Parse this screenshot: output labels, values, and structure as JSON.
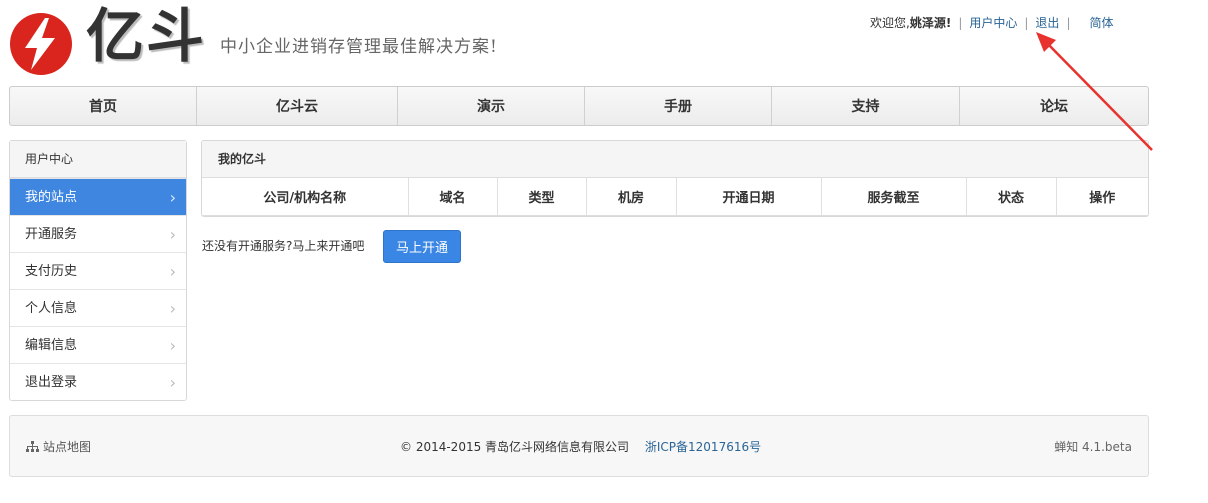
{
  "header": {
    "brand": "亿斗",
    "slogan": "中小企业进销存管理最佳解决方案!",
    "greeting": "欢迎您,",
    "username": "姚泽源!",
    "user_center": "用户中心",
    "logout": "退出",
    "language": "简体"
  },
  "nav": [
    {
      "label": "首页"
    },
    {
      "label": "亿斗云"
    },
    {
      "label": "演示"
    },
    {
      "label": "手册"
    },
    {
      "label": "支持"
    },
    {
      "label": "论坛"
    }
  ],
  "sidebar": {
    "title": "用户中心",
    "items": [
      {
        "label": "我的站点",
        "active": true
      },
      {
        "label": "开通服务"
      },
      {
        "label": "支付历史"
      },
      {
        "label": "个人信息"
      },
      {
        "label": "编辑信息"
      },
      {
        "label": "退出登录"
      }
    ]
  },
  "main": {
    "title": "我的亿斗",
    "columns": [
      "公司/机构名称",
      "域名",
      "类型",
      "机房",
      "开通日期",
      "服务截至",
      "状态",
      "操作"
    ],
    "empty_text": "还没有开通服务?马上来开通吧",
    "open_button": "马上开通"
  },
  "footer": {
    "sitemap": "站点地图",
    "copyright": "© 2014-2015 青岛亿斗网络信息有限公司",
    "icp": "浙ICP备12017616号",
    "version": "蝉知 4.1.beta"
  },
  "colors": {
    "accent": "#3f86e0",
    "logo_red": "#d9251d",
    "annotation_arrow": "#e8322d"
  }
}
